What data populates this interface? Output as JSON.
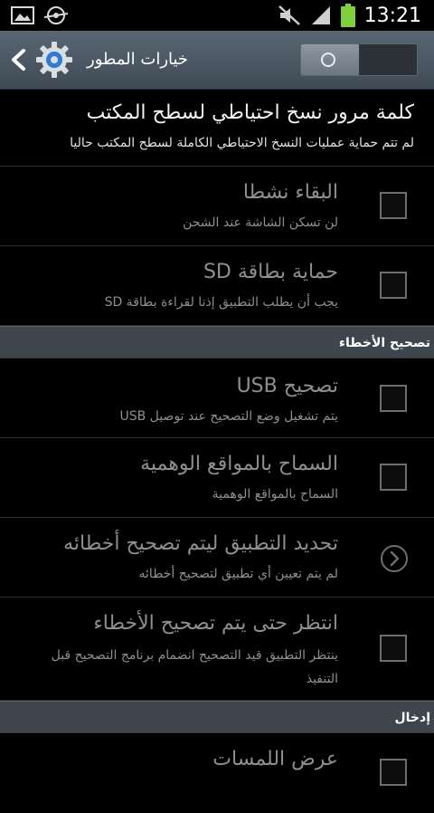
{
  "status_bar": {
    "time": "13:21",
    "icons": [
      "gallery-icon",
      "location-icon",
      "mute-icon",
      "signal-icon",
      "battery-icon"
    ],
    "battery_color": "#7ed13a"
  },
  "action_bar": {
    "title": "خيارات المطور",
    "icons": [
      "back-chevron-icon",
      "gear-icon"
    ],
    "toggle_state": "off"
  },
  "colors": {
    "header_bg": "#3e454d",
    "action_bar_bg": "#4f5a65",
    "checkbox_border": "#6e6e6e",
    "dim_text": "#8f8f8f"
  },
  "items": [
    {
      "title": "كلمة مرور نسخ احتياطي لسطح المكتب",
      "subtitle": "لم تتم حماية عمليات النسخ الاحتياطي الكاملة لسطح المكتب حاليا"
    },
    {
      "title": "البقاء نشطا",
      "subtitle": "لن تسكن الشاشة عند الشحن",
      "checked": false
    },
    {
      "title": "حماية بطاقة SD",
      "subtitle": "يجب أن يطلب التطبيق إذنا لقراءة بطاقة SD",
      "checked": false
    }
  ],
  "sections": [
    {
      "label": "تصحيح الأخطاء",
      "items": [
        {
          "title": "تصحيح USB",
          "subtitle": "يتم تشغيل وضع التصحيح عند توصيل USB",
          "checked": false
        },
        {
          "title": "السماح بالمواقع الوهمية",
          "subtitle": "السماح بالمواقع الوهمية",
          "checked": false
        },
        {
          "title": "تحديد التطبيق ليتم تصحيح أخطائه",
          "subtitle": "لم يتم تعيين أي تطبيق لتصحيح أخطائه",
          "icon": "chevron-right-circle-icon"
        },
        {
          "title": "انتظر حتى يتم تصحيح الأخطاء",
          "subtitle_line1": "ينتظر التطبيق قيد التصحيح انضمام برنامج التصحيح قبل",
          "subtitle_line2": "التنفيذ",
          "checked": false
        }
      ]
    },
    {
      "label": "إدخال",
      "items": [
        {
          "title": "عرض اللمسات",
          "checked": false
        }
      ]
    }
  ]
}
